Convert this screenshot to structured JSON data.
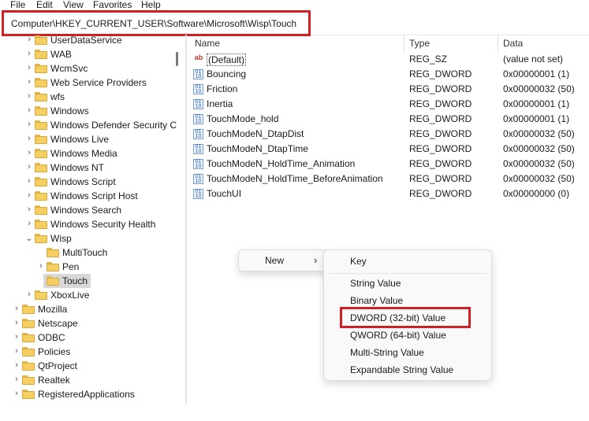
{
  "menu": [
    "File",
    "Edit",
    "View",
    "Favorites",
    "Help"
  ],
  "address": "Computer\\HKEY_CURRENT_USER\\Software\\Microsoft\\Wisp\\Touch",
  "tree": [
    {
      "label": "UserDataService",
      "chevron": "›"
    },
    {
      "label": "WAB",
      "chevron": "›"
    },
    {
      "label": "WcmSvc",
      "chevron": "›"
    },
    {
      "label": "Web Service Providers",
      "chevron": "›"
    },
    {
      "label": "wfs",
      "chevron": "›"
    },
    {
      "label": "Windows",
      "chevron": "›"
    },
    {
      "label": "Windows Defender Security C",
      "chevron": "›"
    },
    {
      "label": "Windows Live",
      "chevron": "›"
    },
    {
      "label": "Windows Media",
      "chevron": "›"
    },
    {
      "label": "Windows NT",
      "chevron": "›"
    },
    {
      "label": "Windows Script",
      "chevron": "›"
    },
    {
      "label": "Windows Script Host",
      "chevron": "›"
    },
    {
      "label": "Windows Search",
      "chevron": "›"
    },
    {
      "label": "Windows Security Health",
      "chevron": "›"
    },
    {
      "label": "Wisp",
      "chevron": "⌄"
    },
    {
      "label": "MultiTouch",
      "chevron": ""
    },
    {
      "label": "Pen",
      "chevron": "›"
    },
    {
      "label": "Touch",
      "chevron": ""
    },
    {
      "label": "XboxLive",
      "chevron": "›"
    },
    {
      "label": "Mozilla",
      "chevron": "›"
    },
    {
      "label": "Netscape",
      "chevron": "›"
    },
    {
      "label": "ODBC",
      "chevron": "›"
    },
    {
      "label": "Policies",
      "chevron": "›"
    },
    {
      "label": "QtProject",
      "chevron": "›"
    },
    {
      "label": "Realtek",
      "chevron": "›"
    },
    {
      "label": "RegisteredApplications",
      "chevron": "›"
    }
  ],
  "columns": {
    "name": "Name",
    "type": "Type",
    "data": "Data"
  },
  "values": [
    {
      "name": "(Default)",
      "type": "REG_SZ",
      "data": "(value not set)",
      "icon": "string-value-icon"
    },
    {
      "name": "Bouncing",
      "type": "REG_DWORD",
      "data": "0x00000001 (1)",
      "icon": "binary-value-icon"
    },
    {
      "name": "Friction",
      "type": "REG_DWORD",
      "data": "0x00000032 (50)",
      "icon": "binary-value-icon"
    },
    {
      "name": "Inertia",
      "type": "REG_DWORD",
      "data": "0x00000001 (1)",
      "icon": "binary-value-icon"
    },
    {
      "name": "TouchMode_hold",
      "type": "REG_DWORD",
      "data": "0x00000001 (1)",
      "icon": "binary-value-icon"
    },
    {
      "name": "TouchModeN_DtapDist",
      "type": "REG_DWORD",
      "data": "0x00000032 (50)",
      "icon": "binary-value-icon"
    },
    {
      "name": "TouchModeN_DtapTime",
      "type": "REG_DWORD",
      "data": "0x00000032 (50)",
      "icon": "binary-value-icon"
    },
    {
      "name": "TouchModeN_HoldTime_Animation",
      "type": "REG_DWORD",
      "data": "0x00000032 (50)",
      "icon": "binary-value-icon"
    },
    {
      "name": "TouchModeN_HoldTime_BeforeAnimation",
      "type": "REG_DWORD",
      "data": "0x00000032 (50)",
      "icon": "binary-value-icon"
    },
    {
      "name": "TouchUI",
      "type": "REG_DWORD",
      "data": "0x00000000 (0)",
      "icon": "binary-value-icon"
    }
  ],
  "context_menu": {
    "new_label": "New",
    "new_arrow": "›"
  },
  "submenu": [
    "Key",
    "String Value",
    "Binary Value",
    "DWORD (32-bit) Value",
    "QWORD (64-bit) Value",
    "Multi-String Value",
    "Expandable String Value"
  ],
  "colors": {
    "highlight": "#cf2026",
    "folder": "#f6cf62",
    "selection": "#d8d8d8"
  }
}
